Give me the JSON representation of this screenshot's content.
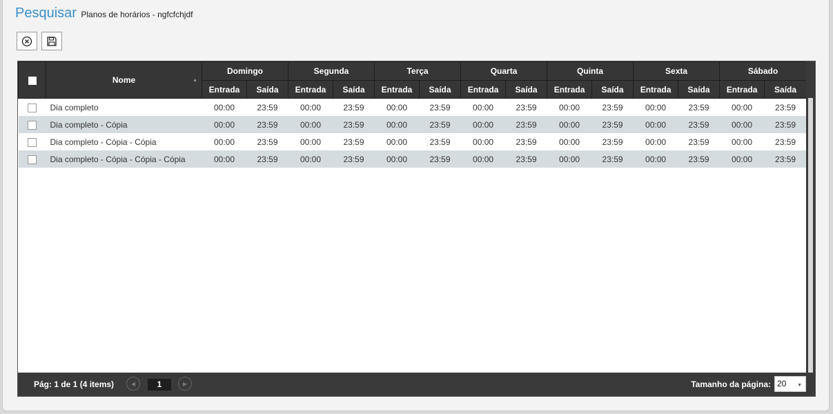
{
  "header": {
    "title": "Pesquisar",
    "subtitle": "Planos de horários - ngfcfchjdf"
  },
  "toolbar": {
    "cancel_icon": "cancel-circle-icon",
    "save_icon": "floppy-disk-icon"
  },
  "grid": {
    "name_header": "Nome",
    "days": [
      "Domingo",
      "Segunda",
      "Terça",
      "Quarta",
      "Quinta",
      "Sexta",
      "Sábado"
    ],
    "entry_label": "Entrada",
    "exit_label": "Saída",
    "rows": [
      {
        "name": "Dia completo",
        "times": [
          "00:00",
          "23:59",
          "00:00",
          "23:59",
          "00:00",
          "23:59",
          "00:00",
          "23:59",
          "00:00",
          "23:59",
          "00:00",
          "23:59",
          "00:00",
          "23:59"
        ]
      },
      {
        "name": "Dia completo - Cópia",
        "times": [
          "00:00",
          "23:59",
          "00:00",
          "23:59",
          "00:00",
          "23:59",
          "00:00",
          "23:59",
          "00:00",
          "23:59",
          "00:00",
          "23:59",
          "00:00",
          "23:59"
        ]
      },
      {
        "name": "Dia completo - Cópia - Cópia",
        "times": [
          "00:00",
          "23:59",
          "00:00",
          "23:59",
          "00:00",
          "23:59",
          "00:00",
          "23:59",
          "00:00",
          "23:59",
          "00:00",
          "23:59",
          "00:00",
          "23:59"
        ]
      },
      {
        "name": "Dia completo - Cópia - Cópia - Cópia",
        "times": [
          "00:00",
          "23:59",
          "00:00",
          "23:59",
          "00:00",
          "23:59",
          "00:00",
          "23:59",
          "00:00",
          "23:59",
          "00:00",
          "23:59",
          "00:00",
          "23:59"
        ]
      }
    ]
  },
  "pager": {
    "info": "Pág: 1 de 1 (4 items)",
    "current_page": "1",
    "page_size_label": "Tamanho da página:",
    "page_size": "20"
  },
  "colors": {
    "title_blue": "#3a8fc6",
    "header_dark": "#363636",
    "alt_row": "#d5dcdf"
  }
}
